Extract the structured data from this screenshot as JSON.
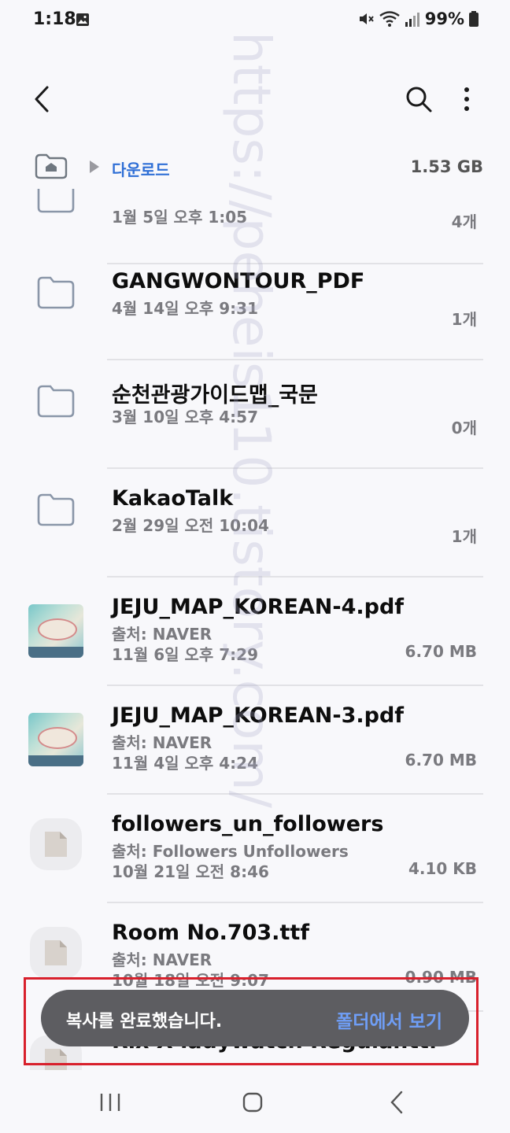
{
  "status_bar": {
    "time": "1:18",
    "battery": "99%"
  },
  "path": {
    "current_folder": "다운로드",
    "storage_size": "1.53 GB"
  },
  "items": [
    {
      "type": "folder",
      "name": "",
      "date": "1월 5일 오후 1:05",
      "count": "4개"
    },
    {
      "type": "folder",
      "name": "GANGWONTOUR_PDF",
      "date": "4월 14일 오후 9:31",
      "count": "1개"
    },
    {
      "type": "folder",
      "name": "순천관광가이드맵_국문",
      "date": "3월 10일 오후 4:57",
      "count": "0개"
    },
    {
      "type": "folder",
      "name": "KakaoTalk",
      "date": "2월 29일 오전 10:04",
      "count": "1개"
    },
    {
      "type": "pdf",
      "name": "JEJU_MAP_KOREAN-4.pdf",
      "source": "출처: NAVER",
      "date": "11월 6일 오후 7:29",
      "size": "6.70 MB"
    },
    {
      "type": "pdf",
      "name": "JEJU_MAP_KOREAN-3.pdf",
      "source": "출처: NAVER",
      "date": "11월 4일 오후 4:24",
      "size": "6.70 MB"
    },
    {
      "type": "file",
      "name": "followers_un_followers",
      "source": "출처: Followers Unfollowers",
      "date": "10월 21일 오전 8:46",
      "size": "4.10 KB"
    },
    {
      "type": "file",
      "name": "Room No.703.ttf",
      "source": "출처: NAVER",
      "date": "10월 18일 오전 9:07",
      "size": "0.90 MB"
    },
    {
      "type": "file",
      "name": "Rix X ladywatch Regular.ttf"
    }
  ],
  "toast": {
    "message": "복사를 완료했습니다.",
    "action": "폴더에서 보기"
  },
  "watermark": "https://peheis110.tistory.com/"
}
